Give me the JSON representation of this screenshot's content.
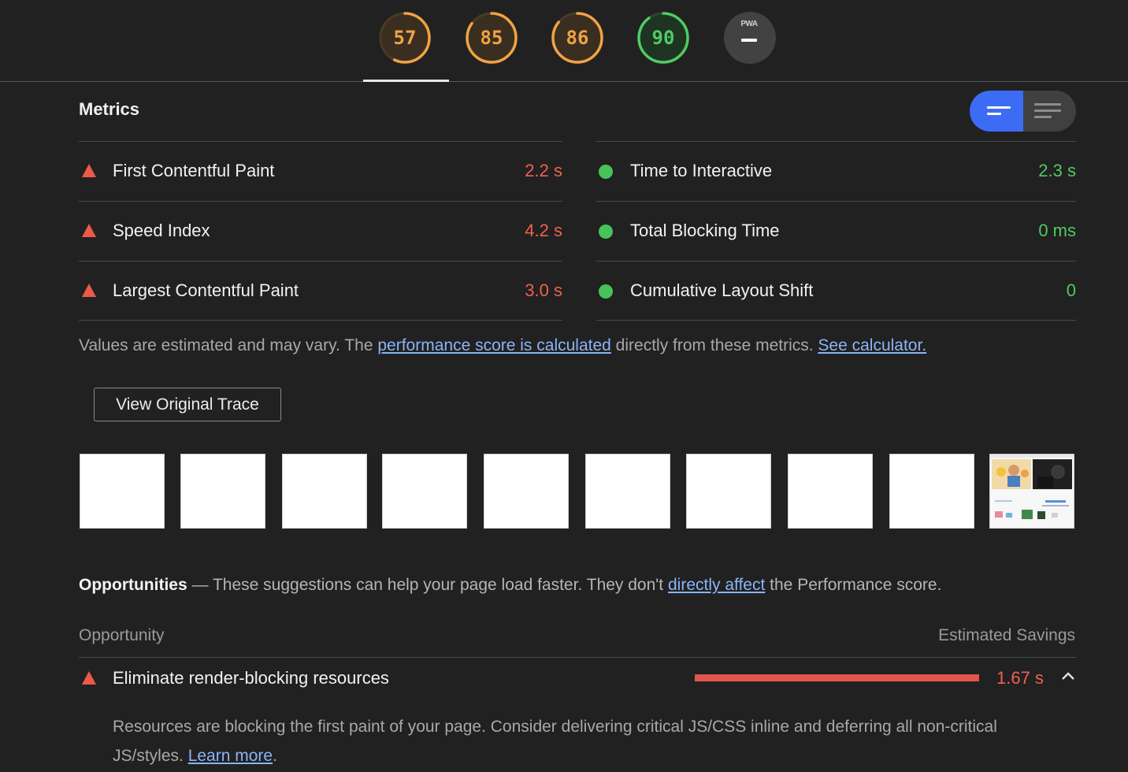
{
  "gauges": [
    {
      "label": "57",
      "score": 57,
      "color": "#f0a343"
    },
    {
      "label": "85",
      "score": 85,
      "color": "#f0a343"
    },
    {
      "label": "86",
      "score": 86,
      "color": "#f0a343"
    },
    {
      "label": "90",
      "score": 90,
      "color": "#4fcb63"
    }
  ],
  "pwa": {
    "label": "PWA"
  },
  "metrics": {
    "title": "Metrics",
    "toggle": {
      "active": "compact-view",
      "inactive": "expanded-view"
    },
    "left": [
      {
        "label": "First Contentful Paint",
        "value": "2.2 s",
        "status": "fail"
      },
      {
        "label": "Speed Index",
        "value": "4.2 s",
        "status": "fail"
      },
      {
        "label": "Largest Contentful Paint",
        "value": "3.0 s",
        "status": "fail"
      }
    ],
    "right": [
      {
        "label": "Time to Interactive",
        "value": "2.3 s",
        "status": "pass"
      },
      {
        "label": "Total Blocking Time",
        "value": "0 ms",
        "status": "pass"
      },
      {
        "label": "Cumulative Layout Shift",
        "value": "0",
        "status": "pass"
      }
    ],
    "note": {
      "prefix": "Values are estimated and may vary. The ",
      "link1": "performance score is calculated",
      "middle": " directly from these metrics. ",
      "link2": "See calculator."
    },
    "trace_button": "View Original Trace"
  },
  "filmstrip": {
    "frames": 10,
    "last_frame_has_content": true
  },
  "opportunities": {
    "heading": "Opportunities",
    "dash": " — ",
    "intro_prefix": "These suggestions can help your page load faster. They don't ",
    "intro_link": "directly affect",
    "intro_suffix": " the Performance score.",
    "col_left": "Opportunity",
    "col_right": "Estimated Savings",
    "items": [
      {
        "title": "Eliminate render-blocking resources",
        "savings": "1.67 s",
        "bar_fraction": 1.0,
        "description": "Resources are blocking the first paint of your page. Consider delivering critical JS/CSS inline and deferring all non-critical JS/styles. ",
        "learn_more": "Learn more",
        "period": "."
      }
    ]
  },
  "colors": {
    "fail": "#f06150",
    "pass": "#4fcb63",
    "average": "#f0a343",
    "accent": "#3d6cf4"
  }
}
